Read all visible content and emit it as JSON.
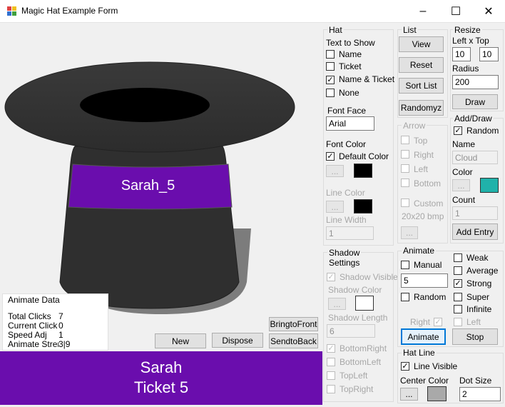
{
  "window": {
    "title": "Magic Hat Example Form",
    "minimize_glyph": "–",
    "maximize_glyph": "☐",
    "close_glyph": "✕"
  },
  "hat": {
    "band_text": "Sarah_5",
    "band_color": "#6a0dad",
    "body_color": "#333333"
  },
  "animate_data": {
    "title": "Animate Data",
    "rows": [
      {
        "label": "Total Clicks",
        "value": "7"
      },
      {
        "label": "Current Click",
        "value": "0"
      },
      {
        "label": "Speed Adj",
        "value": "1"
      },
      {
        "label": "Animate Streng",
        "value": "3|9"
      }
    ]
  },
  "bottom_buttons": {
    "new": "New",
    "dispose": "Dispose",
    "bring_to_front": "BringtoFront",
    "send_to_back": "SendtoBack"
  },
  "banner": {
    "line1": "Sarah",
    "line2": "Ticket 5",
    "color": "#6a0dad"
  },
  "hat_group": {
    "title": "Hat",
    "text_to_show": "Text to Show",
    "options": [
      {
        "label": "Name",
        "checked": false
      },
      {
        "label": "Ticket",
        "checked": false
      },
      {
        "label": "Name & Ticket",
        "checked": true
      },
      {
        "label": "None",
        "checked": false
      }
    ],
    "font_face_label": "Font Face",
    "font_face_value": "Arial",
    "font_color_label": "Font Color",
    "default_color_label": "Default Color",
    "default_color_checked": true,
    "ellipsis": "...",
    "font_color_swatch": "#000000",
    "line_color_label": "Line Color",
    "line_color_swatch": "#000000",
    "line_width_label": "Line Width",
    "line_width_value": "1"
  },
  "list_group": {
    "title": "List",
    "view": "View",
    "reset": "Reset",
    "sort_list": "Sort List",
    "randomyz": "Randomyz"
  },
  "arrow_group": {
    "title": "Arrow",
    "options": [
      "Top",
      "Right",
      "Left",
      "Bottom"
    ],
    "custom_label": "Custom",
    "bmp_label": "20x20 bmp",
    "ellipsis": "..."
  },
  "resize_group": {
    "title": "Resize",
    "left_top_label": "Left x Top",
    "left_value": "10",
    "top_value": "10",
    "radius_label": "Radius",
    "radius_value": "200",
    "draw": "Draw"
  },
  "add_draw_group": {
    "title": "Add/Draw",
    "random_label": "Random",
    "random_checked": true,
    "name_label": "Name",
    "name_value": "Cloud",
    "color_label": "Color",
    "ellipsis": "...",
    "color_swatch": "#20b2aa",
    "count_label": "Count",
    "count_value": "1",
    "add_entry": "Add Entry"
  },
  "shadow_group": {
    "title_line1": "Shadow",
    "title_line2": "Settings",
    "shadow_visible": "Shadow Visible",
    "shadow_color_label": "Shadow Color",
    "ellipsis": "...",
    "shadow_swatch": "#ffffff",
    "shadow_length_label": "Shadow Length",
    "shadow_length_value": "6",
    "positions": [
      {
        "label": "BottomRight",
        "checked": true
      },
      {
        "label": "BottomLeft",
        "checked": false
      },
      {
        "label": "TopLeft",
        "checked": false
      },
      {
        "label": "TopRight",
        "checked": false
      }
    ]
  },
  "animate_group": {
    "title": "Animate",
    "manual_label": "Manual",
    "manual_value": "5",
    "random_label": "Random",
    "right_label": "Right",
    "animate": "Animate",
    "stop": "Stop",
    "strengths": [
      {
        "label": "Weak",
        "checked": false
      },
      {
        "label": "Average",
        "checked": false
      },
      {
        "label": "Strong",
        "checked": true
      },
      {
        "label": "Super",
        "checked": false
      },
      {
        "label": "Infinite",
        "checked": false
      },
      {
        "label": "Left",
        "checked": false,
        "disabled": true
      }
    ]
  },
  "hat_line_group": {
    "title": "Hat Line",
    "line_visible": "Line Visible",
    "center_color_label": "Center Color",
    "dot_size_label": "Dot Size",
    "ellipsis": "...",
    "center_swatch": "#a9a9a9",
    "dot_size_value": "2"
  }
}
